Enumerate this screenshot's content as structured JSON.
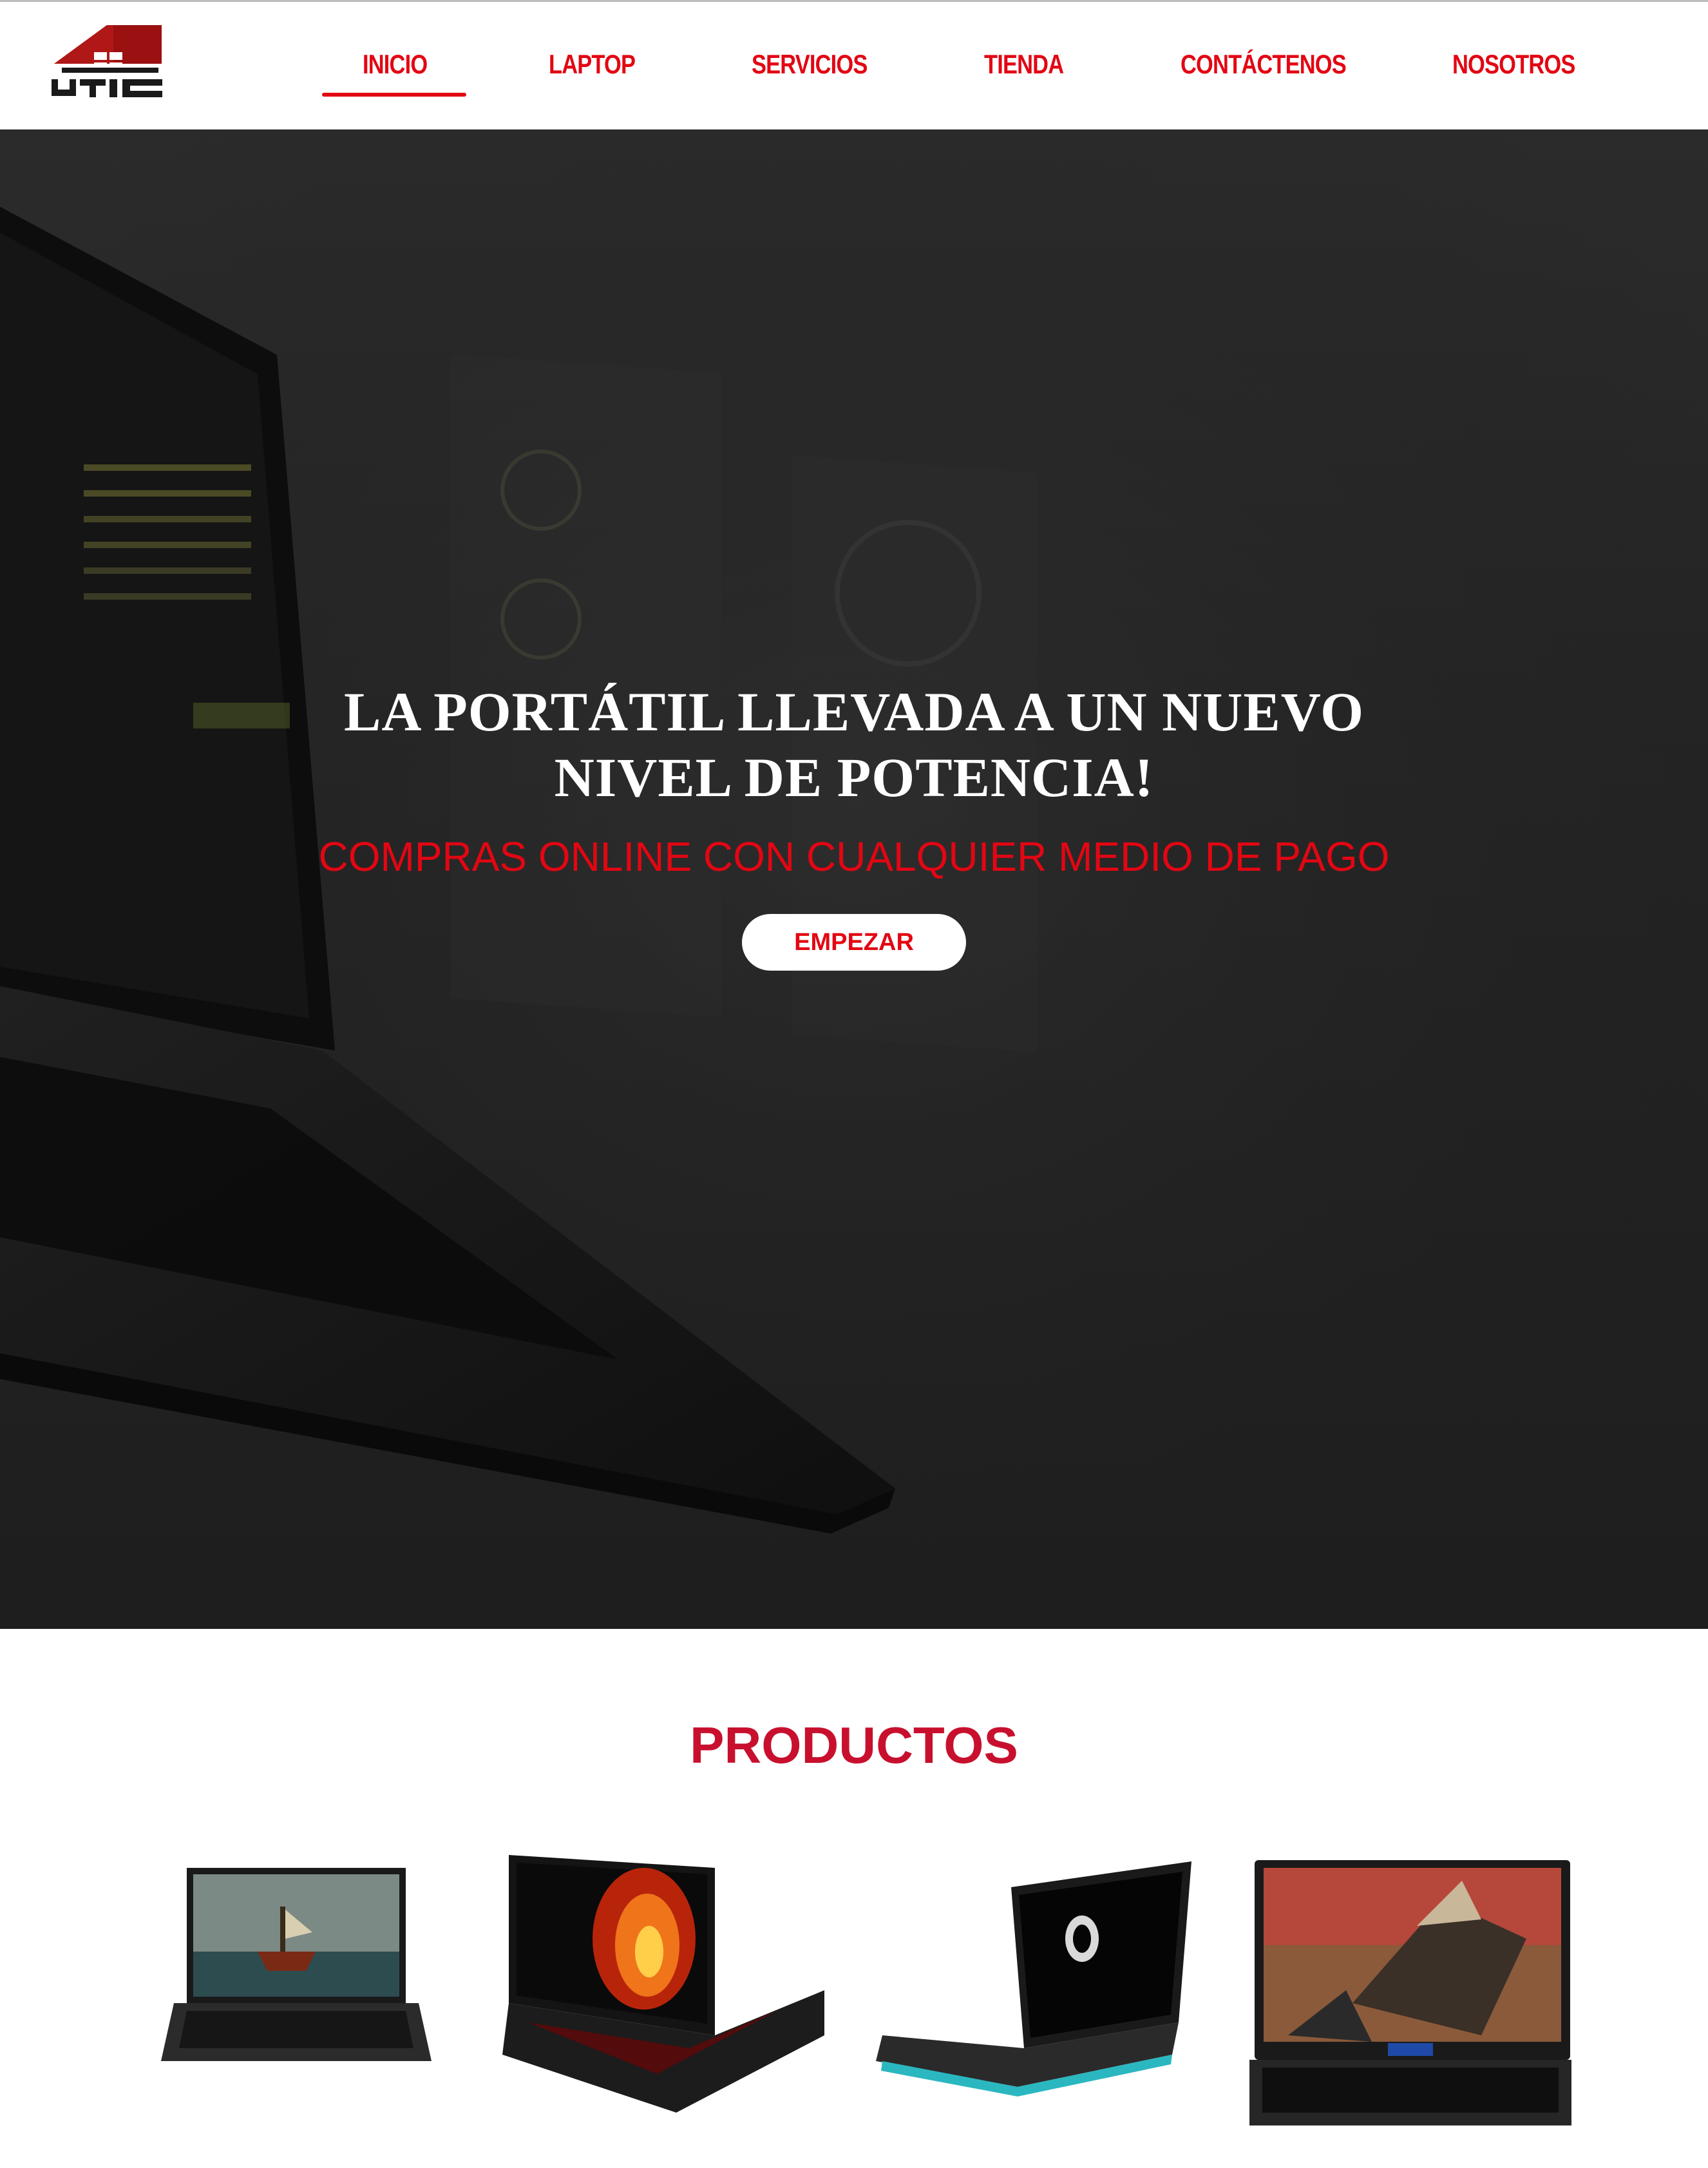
{
  "brand": {
    "logo_text": "UTIC",
    "accent_color": "#e30613",
    "dark_color": "#222222"
  },
  "nav": {
    "items": [
      {
        "label": "INICIO",
        "active": true
      },
      {
        "label": "LAPTOP"
      },
      {
        "label": "SERVICIOS"
      },
      {
        "label": "TIENDA"
      },
      {
        "label": "CONTÁCTENOS"
      },
      {
        "label": "NOSOTROS"
      }
    ]
  },
  "hero": {
    "title_line1": "LA PORTÁTIL LLEVADA A UN NUEVO",
    "title_line2": "NIVEL DE POTENCIA!",
    "subtitle": "COMPRAS ONLINE CON CUALQUIER MEDIO DE PAGO",
    "button_label": "EMPEZAR"
  },
  "products": {
    "title": "PRODUCTOS",
    "items": [
      {
        "icon": "laptop-image-ship-wallpaper"
      },
      {
        "icon": "laptop-image-fire-wallpaper"
      },
      {
        "icon": "laptop-image-alien-logo"
      },
      {
        "icon": "laptop-image-dragon-wallpaper"
      }
    ]
  }
}
